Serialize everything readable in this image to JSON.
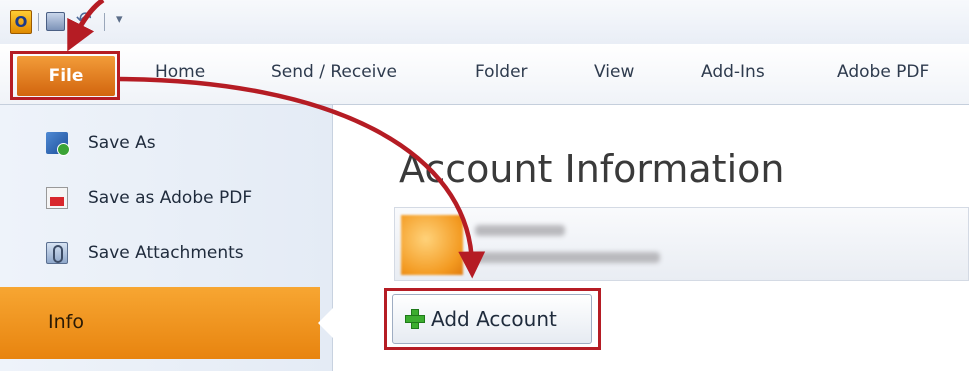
{
  "quick_access": {
    "app_letter": "O",
    "icons": [
      "outlook-icon",
      "save-icon",
      "undo-icon",
      "customize-qat-icon"
    ]
  },
  "ribbon": {
    "file_tab": "File",
    "tabs": [
      "Home",
      "Send / Receive",
      "Folder",
      "View",
      "Add-Ins",
      "Adobe PDF"
    ]
  },
  "backstage": {
    "items": [
      {
        "label": "Save As",
        "icon": "save-as-icon"
      },
      {
        "label": "Save as Adobe PDF",
        "icon": "pdf-icon"
      },
      {
        "label": "Save Attachments",
        "icon": "attachment-icon"
      }
    ],
    "selected": "Info"
  },
  "content": {
    "title": "Account Information",
    "add_account_label": "Add Account"
  },
  "colors": {
    "file_tab": "#e07a1f",
    "selected_nav": "#f59b25",
    "annotation": "#b51c24"
  }
}
